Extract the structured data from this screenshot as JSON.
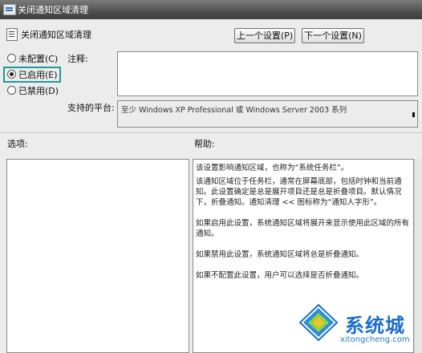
{
  "window": {
    "title": "关闭通知区域清理"
  },
  "header": {
    "title": "关闭通知区域清理"
  },
  "buttons": {
    "prev": "上一个设置(P)",
    "next": "下一个设置(N)"
  },
  "radios": [
    {
      "label": "未配置(C)",
      "checked": false
    },
    {
      "label": "已启用(E)",
      "checked": true
    },
    {
      "label": "已禁用(D)",
      "checked": false
    }
  ],
  "labels": {
    "comment": "注释:",
    "platform": "支持的平台:",
    "options": "选项:",
    "help": "帮助:"
  },
  "comment_value": "",
  "platform_value": "至少 Windows XP Professional 或 Windows Server 2003 系列",
  "help_paragraphs": [
    "该设置影响通知区域，也称为“系统任务栏”。",
    "该通知区域位于任务栏，通常在屏幕底部，包括时钟和当前通知。此设置确定是总是展开项目还是总是折叠项目。默认情况下，折叠通知。通知清理 << 图标称为“通知人字形”。",
    "如果启用此设置，系统通知区域将展开来显示使用此区域的所有通知。",
    "如果禁用此设置，系统通知区域将总是折叠通知。",
    "如果不配置此设置，用户可以选择是否折叠通知。"
  ],
  "watermark": {
    "text": "系统城",
    "url": "xitongcheng.com"
  },
  "colors": {
    "highlight": "#1f9a9a",
    "watermark": "#1d6fc9"
  }
}
